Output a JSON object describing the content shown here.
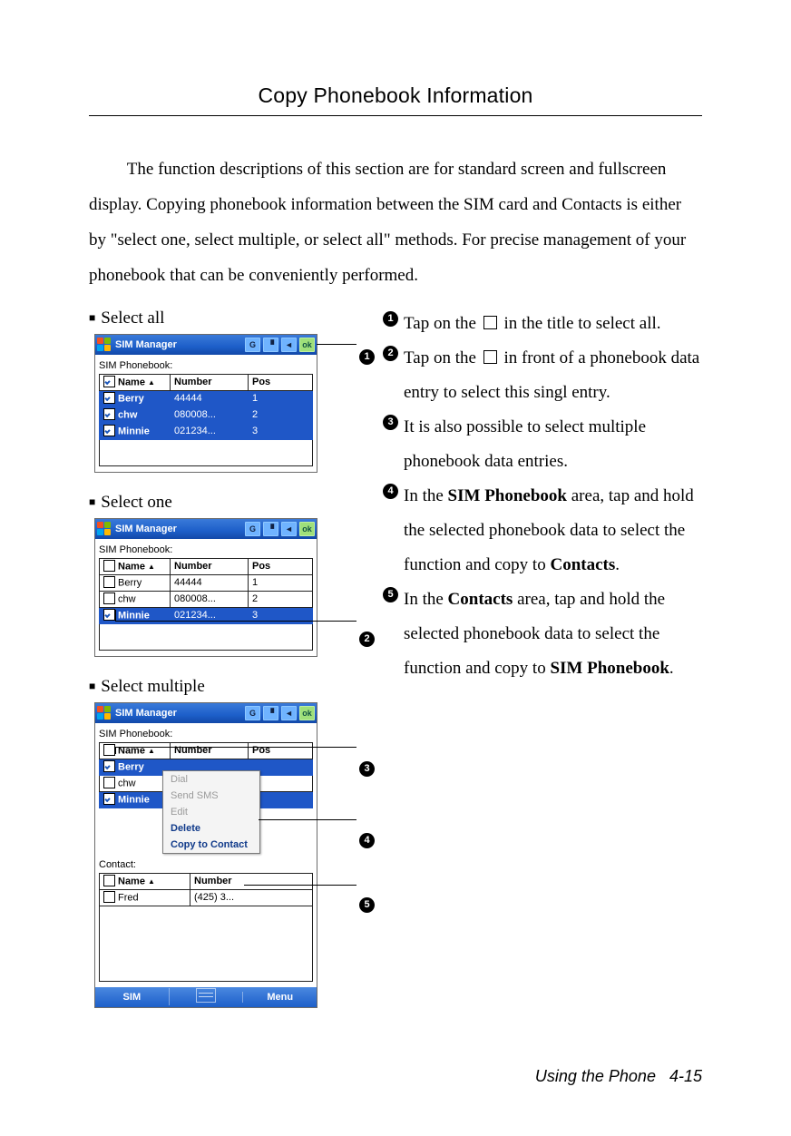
{
  "title": "Copy Phonebook Information",
  "intro": "The function descriptions of this section are for standard screen and fullscreen display. Copying phonebook information between the SIM card and Contacts is either by \"select one, select multiple, or select all\" methods. For precise management of your phonebook that can be conveniently performed.",
  "labels": {
    "select_all": "Select all",
    "select_one": "Select one",
    "select_multiple": "Select multiple"
  },
  "app": {
    "title": "SIM Manager",
    "ok": "ok",
    "sim_label": "SIM Phonebook:",
    "contact_label": "Contact:",
    "cols": {
      "name": "Name",
      "number": "Number",
      "pos": "Pos"
    },
    "soft_left": "SIM",
    "soft_right": "Menu"
  },
  "shot1_rows": [
    {
      "chk": true,
      "name": "Berry",
      "number": "44444",
      "pos": "1",
      "sel": true
    },
    {
      "chk": true,
      "name": "chw",
      "number": "080008...",
      "pos": "2",
      "sel": true
    },
    {
      "chk": true,
      "name": "Minnie",
      "number": "021234...",
      "pos": "3",
      "sel": true
    }
  ],
  "shot1_header_chk": true,
  "shot2_rows": [
    {
      "chk": false,
      "name": "Berry",
      "number": "44444",
      "pos": "1",
      "sel": false
    },
    {
      "chk": false,
      "name": "chw",
      "number": "080008...",
      "pos": "2",
      "sel": false
    },
    {
      "chk": true,
      "name": "Minnie",
      "number": "021234...",
      "pos": "3",
      "sel": true
    }
  ],
  "shot2_header_chk": false,
  "shot3_rows": [
    {
      "chk": true,
      "name": "Berry",
      "sel": true
    },
    {
      "chk": false,
      "name": "chw",
      "sel": false
    },
    {
      "chk": true,
      "name": "Minnie",
      "sel": true
    }
  ],
  "shot3_header_chk": false,
  "shot3_contact_rows": [
    {
      "chk": false,
      "name": "Fred",
      "number": "(425) 3..."
    }
  ],
  "ctxmenu": {
    "dial": "Dial",
    "send_sms": "Send SMS",
    "edit": "Edit",
    "delete": "Delete",
    "copy": "Copy to Contact"
  },
  "markers": {
    "m1": "1",
    "m2": "2",
    "m3": "3",
    "m4": "4",
    "m5": "5"
  },
  "notes": {
    "n1a": "Tap on the ",
    "n1b": " in the title to select all.",
    "n2a": "Tap on the ",
    "n2b": " in front of a phonebook data entry to select this singl entry.",
    "n3": "It is also possible to select multiple phonebook data entries.",
    "n4a": "In the ",
    "n4b": "SIM Phonebook",
    "n4c": " area, tap and hold the selected phonebook data to select the function and copy to ",
    "n4d": "Contacts",
    "n4e": ".",
    "n5a": "In the ",
    "n5b": "Contacts",
    "n5c": " area, tap and hold the selected phonebook data to select the function and copy to ",
    "n5d": "SIM Phonebook",
    "n5e": "."
  },
  "footer": {
    "section": "Using the Phone",
    "page": "4-15"
  }
}
